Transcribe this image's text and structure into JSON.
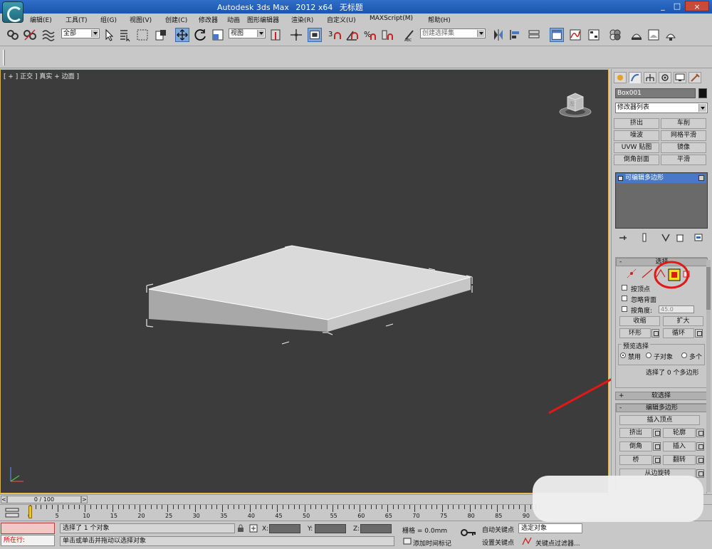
{
  "window": {
    "title_parts": [
      "Autodesk 3ds Max",
      "2012 x64",
      "无标题"
    ],
    "controls": [
      "_",
      "□",
      "×"
    ]
  },
  "menu": [
    "编辑(E)",
    "工具(T)",
    "组(G)",
    "视图(V)",
    "创建(C)",
    "修改器",
    "动画",
    "图形编辑器",
    "渲染(R)",
    "自定义(U)",
    "MAXScript(M)",
    "帮助(H)"
  ],
  "toolbar": {
    "selection_filter": "全部",
    "ref_coord": "视图",
    "named_selection": "创建选择集"
  },
  "viewport": {
    "label": "[ + ] 正交 ] 真实 + 边面 ]",
    "viewcube_label": "左"
  },
  "command_panel": {
    "object_name": "Box001",
    "modifier_list": "修改器列表",
    "modifier_buttons": [
      "挤出",
      "车削",
      "噪波",
      "网格平滑",
      "UVW 贴图",
      "镜像",
      "倒角剖面",
      "平滑"
    ],
    "stack_item": "可编辑多边形",
    "selection_rollout": {
      "title": "选择",
      "by_vertex": "按顶点",
      "ignore_backfacing": "忽略背面",
      "by_angle": "按角度:",
      "angle_value": "45.0",
      "shrink": "收缩",
      "grow": "扩大",
      "ring": "环形",
      "loop": "循环",
      "preview_title": "预览选择",
      "preview_options": [
        "禁用",
        "子对象",
        "多个"
      ],
      "status": "选择了 0 个多边形"
    },
    "soft_selection": "软选择",
    "edit_polygons": {
      "title": "编辑多边形",
      "insert_vertex": "插入顶点",
      "extrude": "挤出",
      "outline": "轮廓",
      "bevel": "倒角",
      "inset": "插入",
      "bridge": "桥",
      "flip": "翻转",
      "hinge": "从边旋转"
    }
  },
  "time": {
    "frame_display": "0 / 100",
    "ticks": [
      "0",
      "5",
      "10",
      "15",
      "20",
      "25",
      "30",
      "35",
      "40",
      "45",
      "50",
      "55",
      "60",
      "65",
      "70",
      "75",
      "80",
      "85",
      "90"
    ]
  },
  "status_bar": {
    "maxscript_label": "所在行:",
    "prompt_1": "选择了 1 个对象",
    "prompt_2": "单击或单击并拖动以选择对象",
    "x_label": "X:",
    "y_label": "Y:",
    "z_label": "Z:",
    "grid": "栅格 = 0.0mm",
    "add_time_tag": "添加时间标记",
    "auto_key": "自动关键点",
    "set_key": "设置关键点",
    "selected": "选定对象",
    "key_filters": "关键点过滤器..."
  },
  "colors": {
    "titlebar": "#1c55ad",
    "viewport_bg": "#3c3c3c",
    "panel_bg": "#c8c8c8",
    "stack_highlight": "#4a78c8",
    "annotation_red": "#e01818",
    "polygon_icon_yellow": "#f7e01a"
  }
}
